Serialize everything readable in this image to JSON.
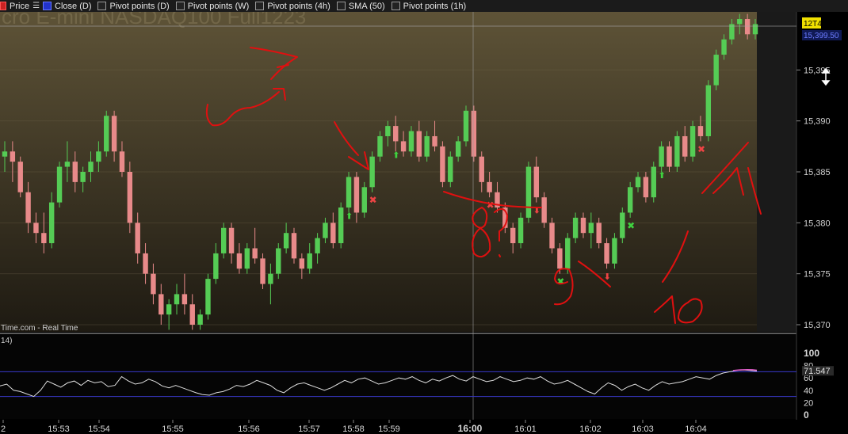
{
  "toolbar": {
    "items": [
      {
        "label": "Price",
        "marker": "red"
      },
      {
        "label": "Close (D)",
        "marker": "blue"
      },
      {
        "label": "Pivot points (D)",
        "marker": "box"
      },
      {
        "label": "Pivot points (W)",
        "marker": "box"
      },
      {
        "label": "Pivot points (4h)",
        "marker": "box"
      },
      {
        "label": "SMA (50)",
        "marker": "box"
      },
      {
        "label": "Pivot points (1h)",
        "marker": "box"
      }
    ],
    "list_icon": "list-icon"
  },
  "watermark": "cro E-mini NASDAQ100 Full1223",
  "source_label": "Time.com - Real Time",
  "indicator_label": "14)",
  "colors": {
    "bull": "#55cc55",
    "bear": "#e88a8a",
    "rsi_line": "#dddddd",
    "band_line": "#3a3acc",
    "annotation": "#e01010",
    "price_tag": "#f0e000"
  },
  "chart_data": {
    "type": "candlestick",
    "price_axis": {
      "ticks": [
        15370,
        15375,
        15380,
        15385,
        15390,
        15395
      ],
      "tick_labels": [
        "15,370",
        "15,375",
        "15,380",
        "15,385",
        "15,390",
        "15,395"
      ],
      "range": [
        15369.3,
        15400.7
      ]
    },
    "current_price": {
      "label": "12T400",
      "value": 15400
    },
    "secondary_price": {
      "label": "15,399.50",
      "value": 15399.5
    },
    "time_axis": {
      "labels": [
        "2",
        "15:53",
        "15:54",
        "15:55",
        "15:56",
        "15:57",
        "15:58",
        "15:59",
        "16:00",
        "16:01",
        "16:02",
        "16:03",
        "16:04"
      ],
      "bold": "16:00"
    },
    "rsi": {
      "ticks": [
        100,
        80,
        60,
        40,
        20,
        0
      ],
      "range": [
        0,
        100
      ],
      "bands": [
        70,
        30
      ],
      "current": {
        "label": "71.547",
        "value": 71.5
      },
      "values": [
        47,
        50,
        40,
        38,
        34,
        30,
        40,
        55,
        50,
        45,
        52,
        55,
        48,
        56,
        52,
        54,
        46,
        48,
        62,
        55,
        50,
        52,
        58,
        54,
        47,
        44,
        48,
        44,
        40,
        36,
        33,
        32,
        36,
        38,
        42,
        48,
        46,
        50,
        56,
        52,
        48,
        40,
        36,
        44,
        50,
        52,
        48,
        44,
        40,
        44,
        50,
        56,
        52,
        58,
        60,
        55,
        50,
        52,
        56,
        60,
        58,
        62,
        56,
        52,
        58,
        55,
        60,
        64,
        58,
        55,
        62,
        58,
        54,
        56,
        62,
        58,
        54,
        56,
        60,
        58,
        62,
        55,
        50,
        52,
        56,
        50,
        44,
        38,
        34,
        44,
        52,
        48,
        40,
        46,
        50,
        44,
        40,
        48,
        54,
        50,
        52,
        54,
        58,
        62,
        60,
        58,
        64,
        68,
        70,
        72,
        73,
        72,
        71
      ]
    },
    "candles": [
      [
        15386.5,
        15388,
        15385,
        15387
      ],
      [
        15387,
        15388,
        15384,
        15386
      ],
      [
        15386,
        15386.5,
        15382.5,
        15383
      ],
      [
        15383,
        15384,
        15379,
        15380
      ],
      [
        15380,
        15381,
        15378,
        15379
      ],
      [
        15379,
        15381,
        15377,
        15378
      ],
      [
        15378,
        15383,
        15377.5,
        15382
      ],
      [
        15382,
        15386,
        15381.5,
        15385.5
      ],
      [
        15385.5,
        15388,
        15384,
        15386
      ],
      [
        15386,
        15387,
        15383,
        15384
      ],
      [
        15384,
        15385.5,
        15383,
        15385
      ],
      [
        15385,
        15387,
        15384,
        15386
      ],
      [
        15386,
        15388,
        15385,
        15387
      ],
      [
        15387,
        15391,
        15386.5,
        15390.5
      ],
      [
        15390.5,
        15391,
        15386,
        15387
      ],
      [
        15387,
        15388,
        15384.5,
        15385
      ],
      [
        15385,
        15386,
        15379,
        15380
      ],
      [
        15380,
        15381,
        15376,
        15377
      ],
      [
        15377,
        15378,
        15374,
        15375
      ],
      [
        15375,
        15376,
        15372,
        15373
      ],
      [
        15373,
        15374,
        15370,
        15371
      ],
      [
        15371,
        15372.5,
        15369.5,
        15372
      ],
      [
        15372,
        15374,
        15371,
        15373
      ],
      [
        15373,
        15375,
        15371,
        15372
      ],
      [
        15372,
        15373,
        15369.5,
        15370
      ],
      [
        15370,
        15371.5,
        15369.5,
        15371
      ],
      [
        15371,
        15375,
        15370.5,
        15374.5
      ],
      [
        15374.5,
        15378,
        15374,
        15377
      ],
      [
        15377,
        15380,
        15376.5,
        15379.5
      ],
      [
        15379.5,
        15380,
        15376,
        15377
      ],
      [
        15377,
        15378,
        15375,
        15375.5
      ],
      [
        15375.5,
        15378,
        15375,
        15377.5
      ],
      [
        15377.5,
        15379.5,
        15376,
        15376.5
      ],
      [
        15376.5,
        15377,
        15373.5,
        15374
      ],
      [
        15374,
        15376,
        15372,
        15375
      ],
      [
        15375,
        15378,
        15374.5,
        15377.5
      ],
      [
        15377.5,
        15380,
        15377,
        15379
      ],
      [
        15379,
        15379.5,
        15376,
        15376.5
      ],
      [
        15376.5,
        15377,
        15374.5,
        15375.5
      ],
      [
        15375.5,
        15378,
        15375,
        15377
      ],
      [
        15377,
        15379,
        15376,
        15378.5
      ],
      [
        15378.5,
        15380.5,
        15378,
        15380
      ],
      [
        15380,
        15381,
        15377.5,
        15378
      ],
      [
        15378,
        15382,
        15377.5,
        15381.5
      ],
      [
        15381.5,
        15385,
        15381,
        15384.5
      ],
      [
        15384.5,
        15385,
        15380,
        15381
      ],
      [
        15381,
        15384,
        15380.5,
        15383.5
      ],
      [
        15383.5,
        15387,
        15383,
        15386.5
      ],
      [
        15386.5,
        15389,
        15386,
        15388.5
      ],
      [
        15388.5,
        15390,
        15387.5,
        15389.5
      ],
      [
        15389.5,
        15390.5,
        15387,
        15388
      ],
      [
        15388,
        15389,
        15386.5,
        15387
      ],
      [
        15387,
        15389.5,
        15386.5,
        15389
      ],
      [
        15389,
        15390,
        15386,
        15386.5
      ],
      [
        15386.5,
        15389,
        15386,
        15388.5
      ],
      [
        15388.5,
        15390,
        15387,
        15387.5
      ],
      [
        15387.5,
        15388,
        15383.5,
        15384
      ],
      [
        15384,
        15387,
        15383.5,
        15386.5
      ],
      [
        15386.5,
        15388.5,
        15386,
        15388
      ],
      [
        15388,
        15391.5,
        15387.5,
        15391
      ],
      [
        15391,
        15391.5,
        15386,
        15386.5
      ],
      [
        15386.5,
        15387,
        15383,
        15384
      ],
      [
        15384,
        15385,
        15382.5,
        15383
      ],
      [
        15383,
        15384,
        15381,
        15381.5
      ],
      [
        15381.5,
        15382,
        15379,
        15379.5
      ],
      [
        15379.5,
        15380,
        15377,
        15378
      ],
      [
        15378,
        15381,
        15377.5,
        15380.5
      ],
      [
        15380.5,
        15386,
        15380,
        15385.5
      ],
      [
        15385.5,
        15386.5,
        15382,
        15382.5
      ],
      [
        15382.5,
        15383,
        15379.5,
        15380
      ],
      [
        15380,
        15380.5,
        15377,
        15377.5
      ],
      [
        15377.5,
        15378,
        15375,
        15375.5
      ],
      [
        15375.5,
        15379,
        15375,
        15378.5
      ],
      [
        15378.5,
        15381,
        15378,
        15380.5
      ],
      [
        15380.5,
        15381,
        15378.5,
        15379
      ],
      [
        15379,
        15381,
        15377.5,
        15380
      ],
      [
        15380,
        15380.5,
        15377.5,
        15378
      ],
      [
        15378,
        15378.5,
        15375.5,
        15376
      ],
      [
        15376,
        15379,
        15375.5,
        15378.5
      ],
      [
        15378.5,
        15381.5,
        15378,
        15381
      ],
      [
        15381,
        15384,
        15380.5,
        15383.5
      ],
      [
        15383.5,
        15385,
        15383,
        15384.5
      ],
      [
        15384.5,
        15385,
        15382,
        15382.5
      ],
      [
        15382.5,
        15386,
        15382,
        15385.5
      ],
      [
        15385.5,
        15388,
        15385,
        15387.5
      ],
      [
        15387.5,
        15388,
        15385,
        15385.5
      ],
      [
        15385.5,
        15389,
        15385,
        15388.5
      ],
      [
        15388.5,
        15389.5,
        15386,
        15386.5
      ],
      [
        15386.5,
        15390,
        15386,
        15389.5
      ],
      [
        15389.5,
        15390.5,
        15388,
        15388.5
      ],
      [
        15388.5,
        15394,
        15388,
        15393.5
      ],
      [
        15393.5,
        15397,
        15393,
        15396.5
      ],
      [
        15396.5,
        15398.5,
        15396,
        15398
      ],
      [
        15398,
        15400,
        15397.5,
        15399.5
      ],
      [
        15399.5,
        15400.5,
        15398.5,
        15400
      ],
      [
        15400,
        15400.5,
        15398,
        15398.5
      ],
      [
        15398.5,
        15400,
        15398,
        15399.5
      ]
    ],
    "markers": [
      {
        "type": "arrow-up",
        "color": "green",
        "index": 44
      },
      {
        "type": "x",
        "color": "red",
        "index": 47
      },
      {
        "type": "arrow-up",
        "color": "green",
        "index": 50
      },
      {
        "type": "x",
        "color": "red",
        "index": 62
      },
      {
        "type": "arrow-down",
        "color": "red",
        "index": 68
      },
      {
        "type": "x",
        "color": "green",
        "index": 71
      },
      {
        "type": "arrow-down",
        "color": "red",
        "index": 77
      },
      {
        "type": "x",
        "color": "green",
        "index": 80
      },
      {
        "type": "arrow-up",
        "color": "green",
        "index": 84
      },
      {
        "type": "x",
        "color": "red",
        "index": 89
      }
    ],
    "annotations": [
      "7",
      "8?",
      "9",
      "10",
      "11"
    ]
  }
}
